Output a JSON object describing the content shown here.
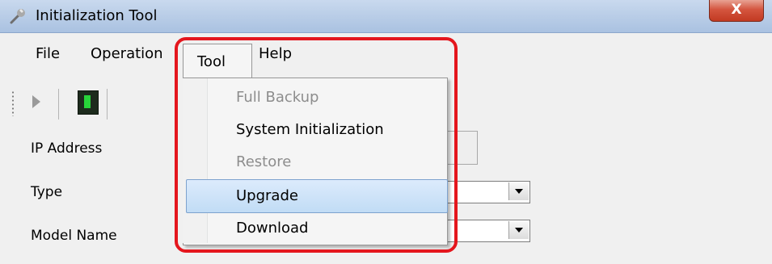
{
  "window": {
    "title": "Initialization Tool",
    "close_label": "X"
  },
  "menubar": {
    "items": [
      {
        "label": "File"
      },
      {
        "label": "Operation"
      },
      {
        "label": "Tool"
      },
      {
        "label": "Help"
      }
    ]
  },
  "toolbar": {
    "icons": [
      "play-icon",
      "device-icon"
    ]
  },
  "form": {
    "ip_label": "IP Address",
    "type_label": "Type",
    "model_label": "Model Name"
  },
  "tool_menu": {
    "items": [
      {
        "label": "Full Backup",
        "enabled": false
      },
      {
        "label": "System Initialization",
        "enabled": true
      },
      {
        "label": "Restore",
        "enabled": false
      },
      {
        "label": "Upgrade",
        "enabled": true,
        "highlighted": true
      },
      {
        "label": "Download",
        "enabled": true
      }
    ]
  },
  "colors": {
    "annotation_border": "#e4161d",
    "highlight": "#c1dcf5"
  }
}
